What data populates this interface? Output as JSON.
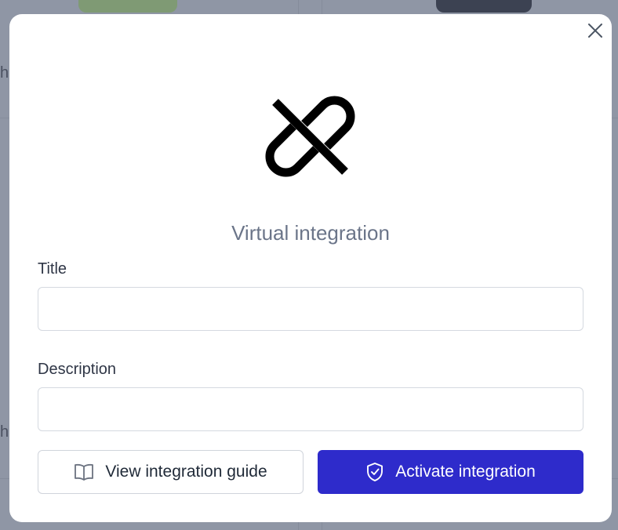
{
  "background": {
    "fragments": [
      "h",
      "h"
    ]
  },
  "modal": {
    "close_icon": "close-icon",
    "hero_icon": "link-broken-icon",
    "title": "Virtual integration",
    "fields": {
      "title": {
        "label": "Title",
        "value": "",
        "placeholder": ""
      },
      "description": {
        "label": "Description",
        "value": "",
        "placeholder": ""
      }
    },
    "buttons": {
      "guide": {
        "label": "View integration guide",
        "icon": "book-open-icon"
      },
      "activate": {
        "label": "Activate integration",
        "icon": "shield-check-icon"
      }
    }
  },
  "colors": {
    "primary": "#2e2bcb",
    "overlay": "#8f96a5",
    "title_text": "#6b7589"
  }
}
